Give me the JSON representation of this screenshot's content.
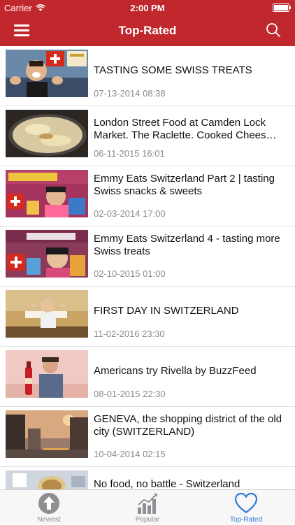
{
  "status_bar": {
    "carrier": "Carrier",
    "time": "2:00 PM"
  },
  "nav": {
    "title": "Top-Rated"
  },
  "videos": [
    {
      "title": "TASTING SOME SWISS TREATS",
      "date": "07-13-2014 08:38"
    },
    {
      "title": "London Street Food at Camden Lock Market. The Raclette. Cooked Chees…",
      "date": "06-11-2015 16:01"
    },
    {
      "title": "Emmy Eats Switzerland Part 2 | tasting Swiss snacks & sweets",
      "date": "02-03-2014 17:00"
    },
    {
      "title": "Emmy Eats Switzerland 4 - tasting more Swiss treats",
      "date": "02-10-2015 01:00"
    },
    {
      "title": "FIRST DAY IN SWITZERLAND",
      "date": "11-02-2016 23:30"
    },
    {
      "title": "Americans try Rivella by BuzzFeed",
      "date": "08-01-2015 22:30"
    },
    {
      "title": "GENEVA, the shopping district of the old city (SWITZERLAND)",
      "date": "10-04-2014 02:15"
    },
    {
      "title": "No food, no battle - Switzerland",
      "date": ""
    }
  ],
  "tabs": [
    {
      "label": "Newest",
      "icon": "arrow-up-circle-icon"
    },
    {
      "label": "Popular",
      "icon": "chart-icon"
    },
    {
      "label": "Top-Rated",
      "icon": "heart-icon"
    }
  ],
  "colors": {
    "brand": "#c0282d",
    "tab_active": "#2f79d6",
    "tab_inactive": "#8e8e93"
  }
}
